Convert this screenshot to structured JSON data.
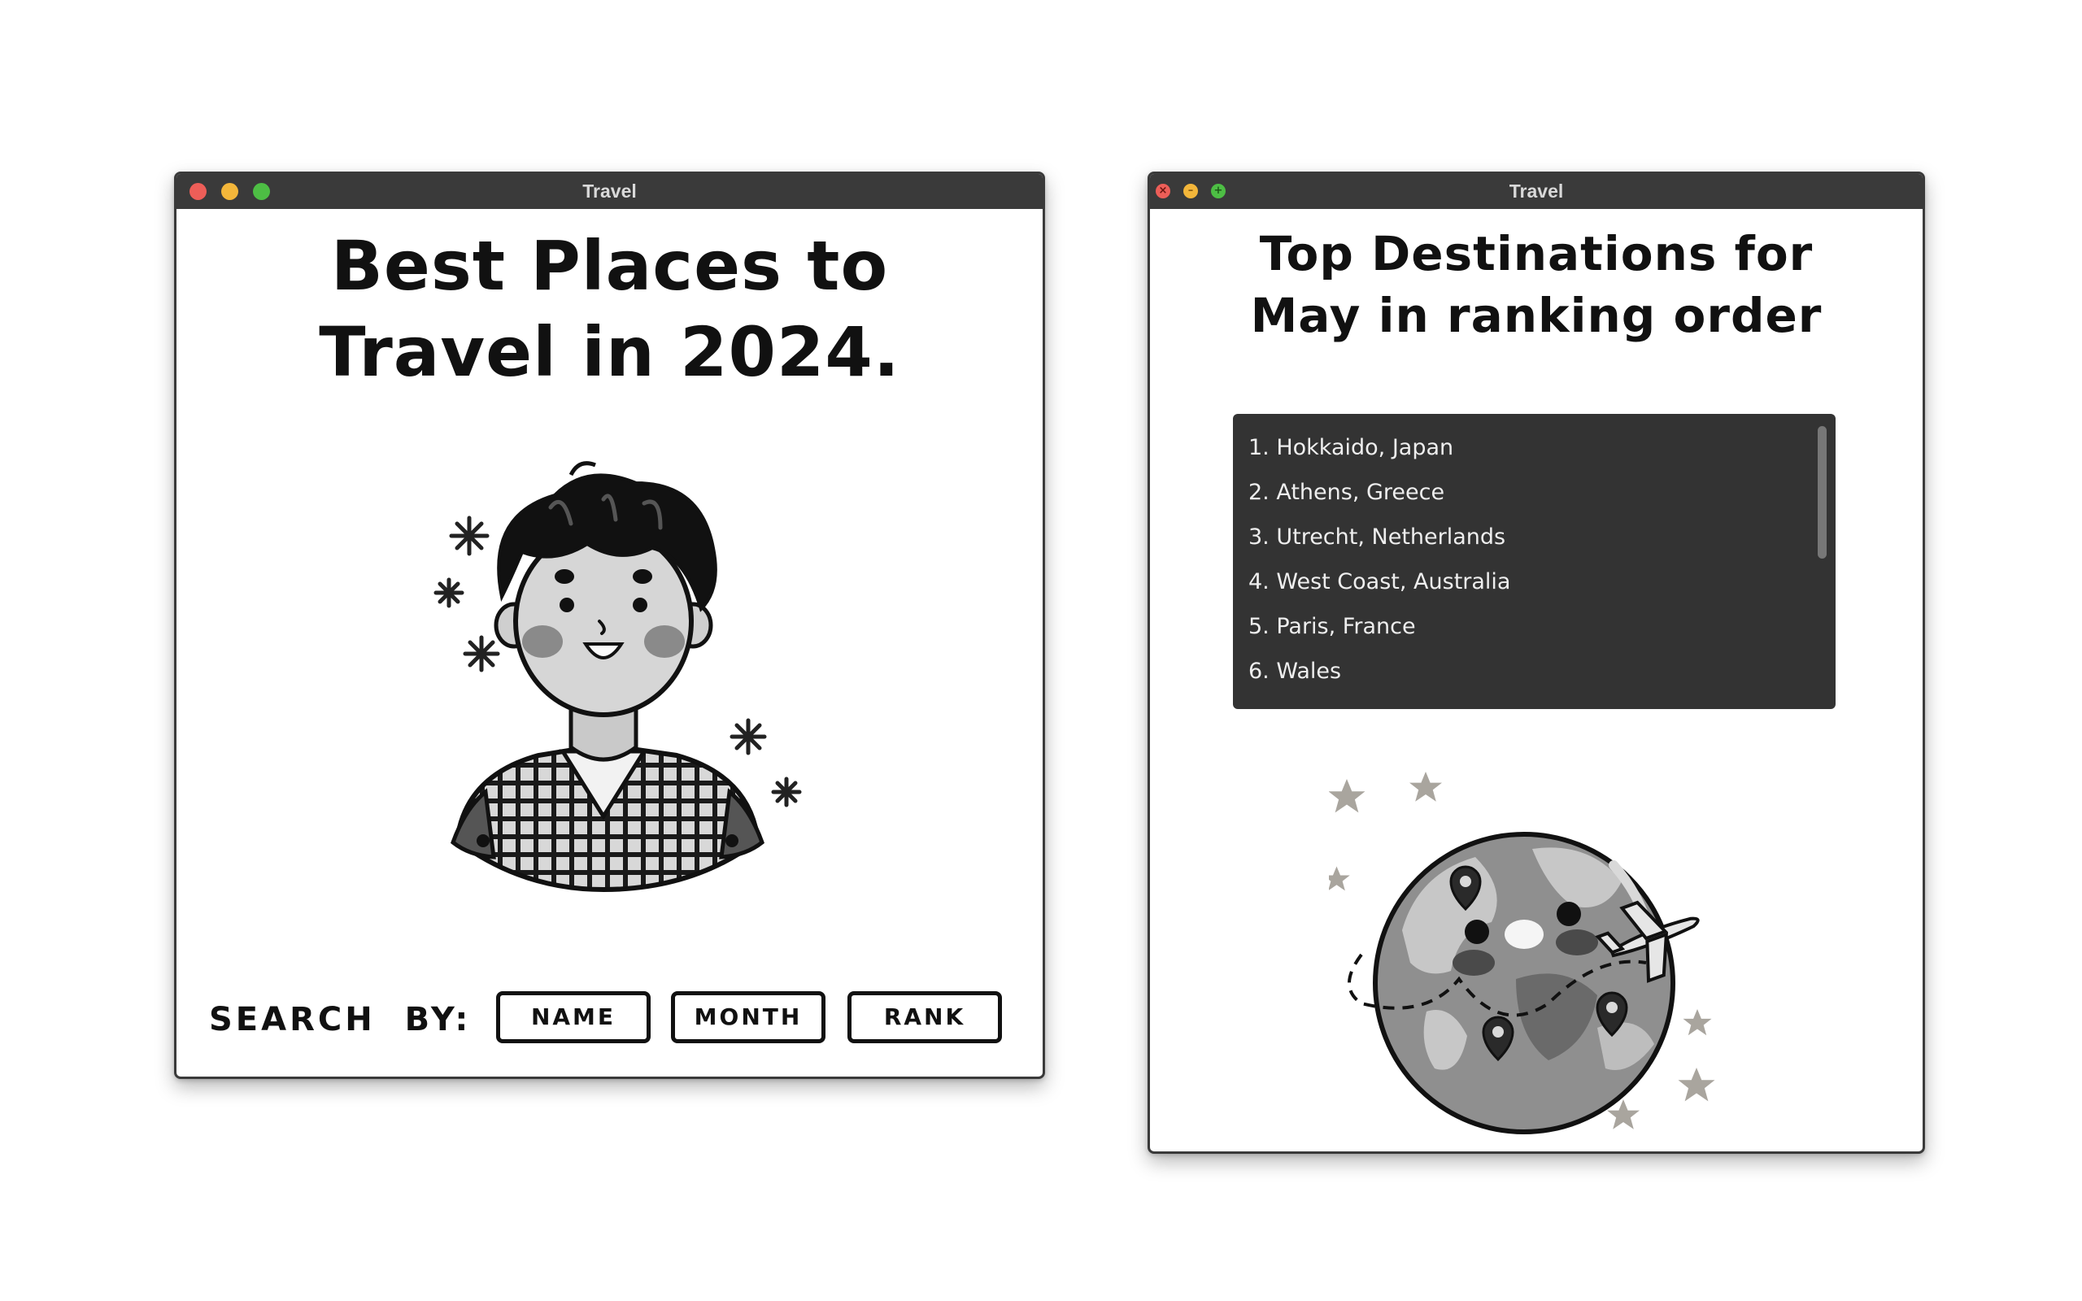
{
  "window_left": {
    "title": "Travel",
    "heading_line1": "Best Places to",
    "heading_line2": "Travel in 2024.",
    "illustration_icon": "boy-avatar-icon",
    "search": {
      "label": "SEARCH  BY:",
      "buttons": [
        "NAME",
        "MONTH",
        "RANK"
      ]
    }
  },
  "window_right": {
    "title": "Travel",
    "heading_line1": "Top Destinations for",
    "heading_line2": "May in ranking order",
    "destinations": [
      "1. Hokkaido, Japan",
      "2. Athens, Greece",
      "3. Utrecht, Netherlands",
      "4. West Coast, Australia",
      "5. Paris, France",
      "6. Wales"
    ],
    "illustration_icon": "globe-airplane-icon"
  },
  "colors": {
    "titlebar": "#3a3a3a",
    "listbox_bg": "#333333",
    "close": "#ed5e58",
    "minimize": "#f3b63a",
    "maximize": "#4dbe44"
  }
}
